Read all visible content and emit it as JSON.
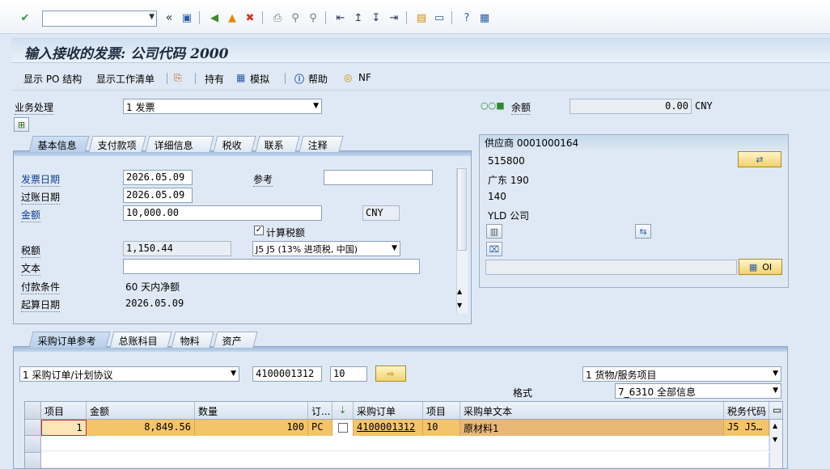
{
  "toolbar": {
    "command_value": "",
    "icons": [
      "enter-icon",
      "save-icon",
      "back-icon",
      "exit-icon",
      "cancel-icon",
      "print-icon",
      "find-icon",
      "find-next-icon",
      "first-page-icon",
      "prev-page-icon",
      "next-page-icon",
      "last-page-icon",
      "new-session-icon",
      "shortcut-icon",
      "help-icon",
      "customize-icon"
    ]
  },
  "title": "输入接收的发票: 公司代码 2000",
  "app_toolbar": {
    "show_po_structure": "显示 PO 结构",
    "show_worklist": "显示工作清单",
    "hold": "持有",
    "simulate": "模拟",
    "help": "帮助",
    "nf": "NF"
  },
  "header": {
    "transaction_label": "业务处理",
    "transaction_value": "1 发票",
    "balance_label": "余额",
    "balance_value": "0.00",
    "balance_currency": "CNY"
  },
  "tabs": [
    "基本信息",
    "支付款项",
    "详细信息",
    "税收",
    "联系",
    "注释"
  ],
  "basic": {
    "invoice_date_label": "发票日期",
    "invoice_date": "2026.05.09",
    "reference_label": "参考",
    "reference_value": "",
    "posting_date_label": "过账日期",
    "posting_date": "2026.05.09",
    "amount_label": "金额",
    "amount": "10,000.00",
    "currency": "CNY",
    "calc_tax_label": "计算税额",
    "calc_tax_checked": true,
    "tax_label": "税额",
    "tax_amount": "1,150.44",
    "tax_code": "J5 J5 (13% 进项税, 中国)",
    "text_label": "文本",
    "text_value": "",
    "payment_terms_label": "付款条件",
    "payment_terms": "60 天内净额",
    "baseline_label": "起算日期",
    "baseline_date": "2026.05.09"
  },
  "vendor": {
    "header": "供应商 0001000164",
    "line1": "515800",
    "line2": "广东  190",
    "line3": "140",
    "line4": "YLD 公司",
    "oi_label": "OI"
  },
  "bottom_tabs": [
    "采购订单参考",
    "总账科目",
    "物料",
    "资产"
  ],
  "po_ref": {
    "ref_type": "1 采购订单/计划协议",
    "po_number": "4100001312",
    "item": "10",
    "item_type": "1 货物/服务项目",
    "layout_label": "格式",
    "layout_value": "7_6310 全部信息"
  },
  "grid": {
    "columns": [
      "项目",
      "金额",
      "数量",
      "订...",
      "",
      "采购订单",
      "项目",
      "采购单文本",
      "税务代码"
    ],
    "rows": [
      {
        "item": "1",
        "amount": "8,849.56",
        "quantity": "100",
        "unit": "PC",
        "po": "4100001312",
        "po_item": "10",
        "text": "原材料1",
        "tax": "J5 J5…"
      }
    ]
  },
  "colors": {
    "selected_row": "#f4c46a",
    "title_text": "#1c2b3c",
    "link": "#0a3d91"
  }
}
